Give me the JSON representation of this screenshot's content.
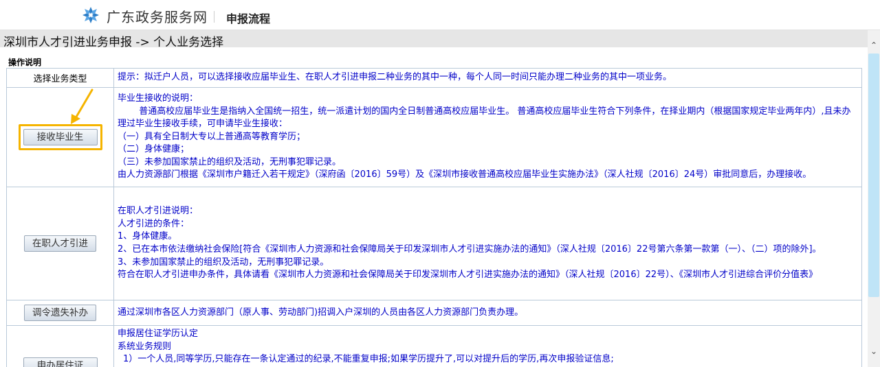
{
  "header": {
    "site_name": "广东政务服务网",
    "subtitle": "申报流程"
  },
  "page_title": "深圳市人才引进业务申报 -> 个人业务选择",
  "section_label": "操作说明",
  "table": {
    "header_left": "选择业务类型",
    "header_hint": "提示：拟迁户人员，可以选择接收应届毕业生、在职人才引进申报二种业务的其中一种，每个人同一时间只能办理二种业务的其中一项业务。",
    "rows": [
      {
        "button": "接收毕业生",
        "lines": [
          "毕业生接收的说明：",
          "普通高校应届毕业生是指纳入全国统一招生，统一派遣计划的国内全日制普通高校应届毕业生。 普通高校应届毕业生符合下列条件，在择业期内（根据国家规定毕业两年内）,且未办理过毕业生接收手续，可申请毕业生接收：",
          "（一）具有全日制大专以上普通高等教育学历；",
          "（二）身体健康；",
          "（三）未参加国家禁止的组织及活动，无刑事犯罪记录。",
          "由人力资源部门根据《深圳市户籍迁入若干规定》（深府函〔2016〕59号）及《深圳市接收普通高校应届毕业生实施办法》（深人社规〔2016〕24号）审批同意后，办理接收。"
        ]
      },
      {
        "button": "在职人才引进",
        "lines": [
          "在职人才引进说明：",
          "人才引进的条件：",
          "1、身体健康。",
          "2、已在本市依法缴纳社会保险[符合《深圳市人力资源和社会保障局关于印发深圳市人才引进实施办法的通知》（深人社规〔2016〕22号第六条第一款第（一）、（二）项的除外]。",
          "3、未参加国家禁止的组织及活动，无刑事犯罪记录。",
          "符合在职人才引进申办条件，具体请看《深圳市人力资源和社会保障局关于印发深圳市人才引进实施办法的通知》（深人社规〔2016〕22号）、《深圳市人才引进综合评价分值表》"
        ]
      },
      {
        "button": "调令遗失补办",
        "lines": [
          "通过深圳市各区人力资源部门（原人事、劳动部门)招调入户深圳的人员由各区人力资源部门负责办理。"
        ]
      },
      {
        "button": "申办居住证",
        "lines": [
          "申报居住证学历认定",
          "系统业务规则",
          "1）一个人员,同等学历,只能存在一条认定通过的纪录,不能重复申报;如果学历提升了,可以对提升后的学历,再次申报验证信息;"
        ]
      }
    ]
  }
}
